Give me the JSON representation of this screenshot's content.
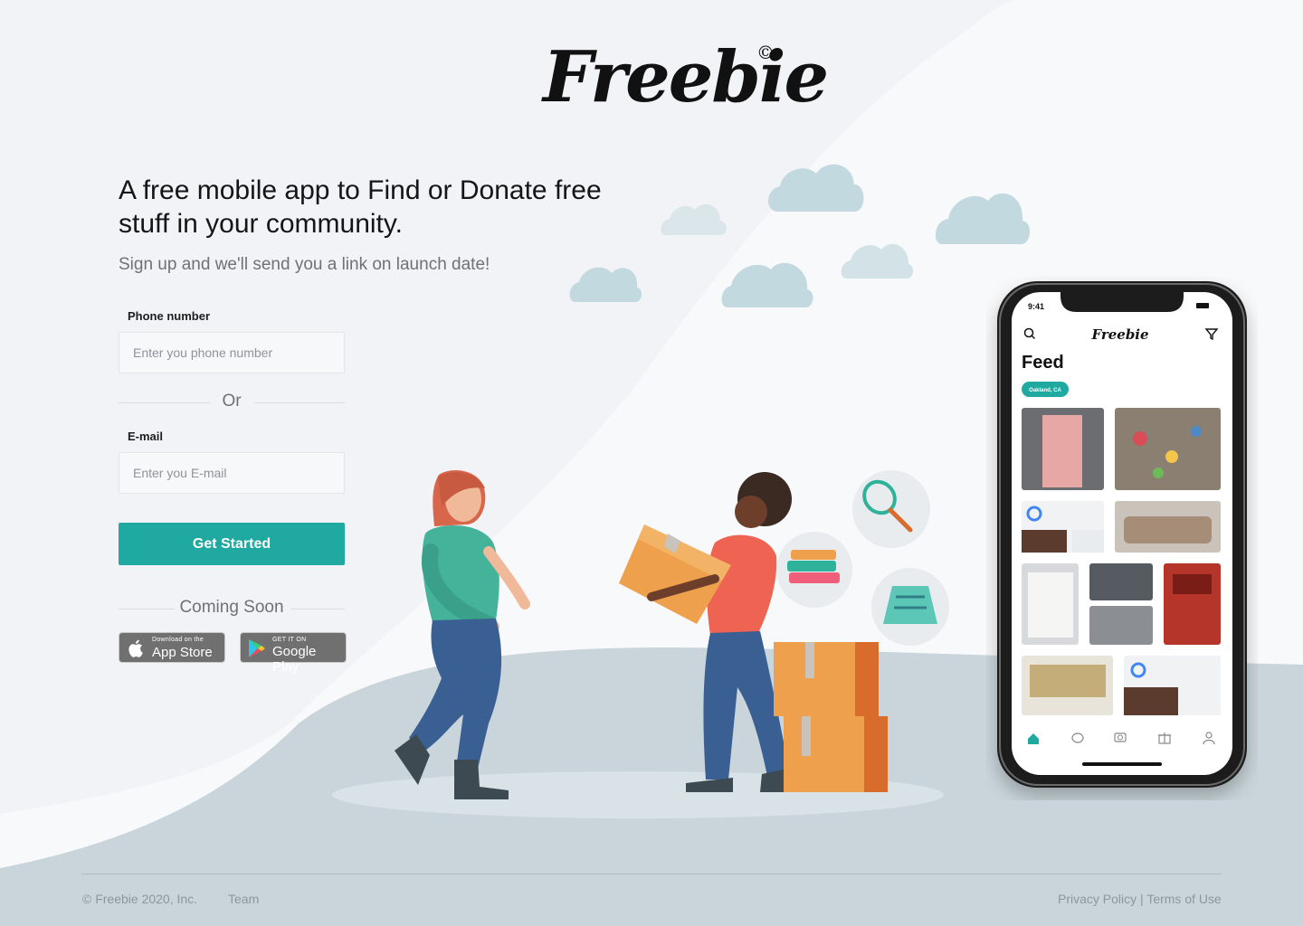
{
  "brand": {
    "name": "Freebie",
    "mark": "©"
  },
  "hero": {
    "headline": "A free mobile app to Find or Donate free stuff in your community.",
    "subheadline": "Sign up and we'll send you a link on launch date!"
  },
  "form": {
    "phone_label": "Phone number",
    "phone_placeholder": "Enter you phone number",
    "or_label": "Or",
    "email_label": "E-mail",
    "email_placeholder": "Enter you E-mail",
    "submit_label": "Get Started"
  },
  "coming_soon": {
    "label": "Coming Soon",
    "app_store": {
      "small": "Download on the",
      "big": "App Store"
    },
    "google_play": {
      "small": "GET IT ON",
      "big": "Google Play"
    }
  },
  "phone_mockup": {
    "time": "9:41",
    "app_name": "Freebie",
    "title": "Feed",
    "location_chip": "Oakland, CA"
  },
  "footer": {
    "copyright": "© Freebie 2020, Inc.",
    "team": "Team",
    "privacy": "Privacy Policy",
    "divider": "|",
    "terms": "Terms of Use"
  },
  "colors": {
    "accent": "#1fa9a1",
    "page_bg": "#f1f3f7",
    "hill": "#c9d5da",
    "cloud": "#c3d9e0",
    "box": "#eea04c"
  },
  "icons": [
    "apple-icon",
    "google-play-icon",
    "search-icon",
    "filter-icon",
    "home-icon",
    "chat-icon",
    "camera-icon",
    "gift-icon",
    "user-icon"
  ]
}
